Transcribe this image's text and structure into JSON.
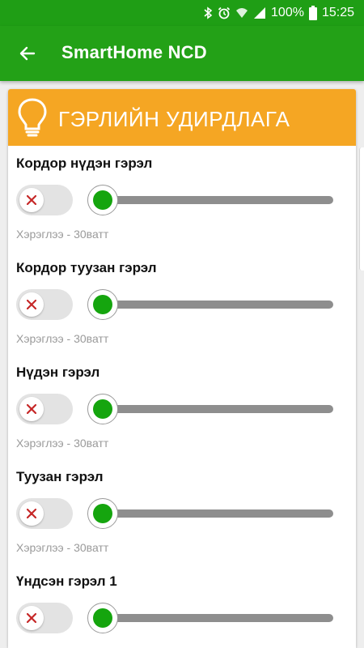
{
  "status_bar": {
    "battery": "100%",
    "time": "15:25",
    "icons": [
      "bluetooth-icon",
      "alarm-icon",
      "wifi-icon",
      "signal-icon",
      "battery-icon"
    ]
  },
  "app_bar": {
    "title": "SmartHome NCD",
    "back_icon": "arrow-left-icon",
    "color": "#23a117"
  },
  "section": {
    "title": "ГЭРЛИЙН УДИРДЛАГА",
    "icon": "lightbulb-icon",
    "color": "#f5a623"
  },
  "lights": [
    {
      "name": "Кордор нүдэн гэрэл",
      "desc": "Хэрэглээ - 30ватт",
      "on": false,
      "level": 0
    },
    {
      "name": "Кордор туузан гэрэл",
      "desc": "Хэрэглээ - 30ватт",
      "on": false,
      "level": 0
    },
    {
      "name": "Нүдэн гэрэл",
      "desc": "Хэрэглээ - 30ватт",
      "on": false,
      "level": 0
    },
    {
      "name": "Туузан гэрэл",
      "desc": "Хэрэглээ - 30ватт",
      "on": false,
      "level": 0
    },
    {
      "name": "Үндсэн гэрэл 1",
      "desc": "",
      "on": false,
      "level": 0
    }
  ],
  "colors": {
    "slider_thumb": "#15a50e",
    "toggle_off_x": "#c62828"
  }
}
